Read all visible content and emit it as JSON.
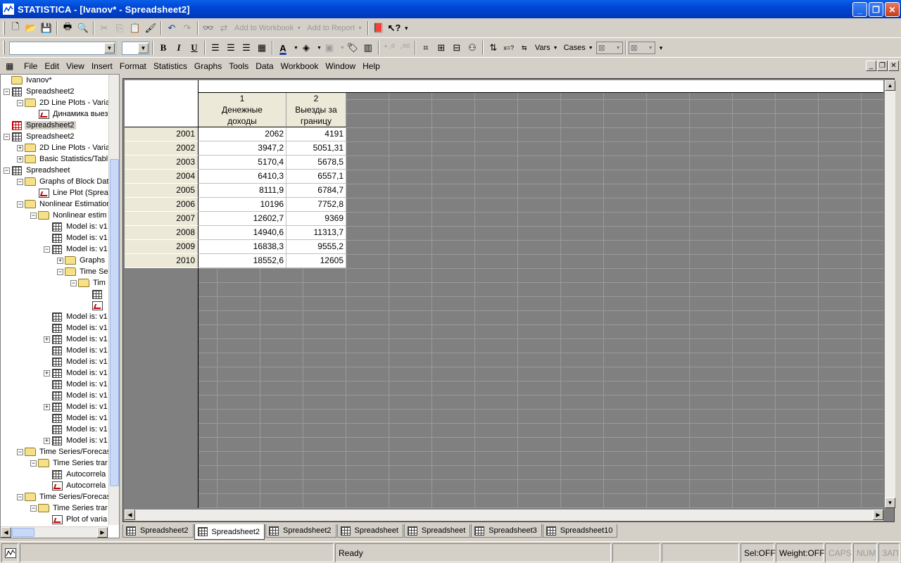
{
  "window": {
    "title": "STATISTICA - [Ivanov* - Spreadsheet2]"
  },
  "toolbar1": {
    "add_to_workbook": "Add to Workbook",
    "add_to_report": "Add to Report"
  },
  "toolbar2": {
    "bold": "B",
    "italic": "I",
    "underline": "U",
    "vars": "Vars",
    "cases": "Cases"
  },
  "menu": [
    "File",
    "Edit",
    "View",
    "Insert",
    "Format",
    "Statistics",
    "Graphs",
    "Tools",
    "Data",
    "Workbook",
    "Window",
    "Help"
  ],
  "tree": [
    {
      "label": "Ivanov*",
      "icon": "folder",
      "level": 0,
      "expander": ""
    },
    {
      "label": "Spreadsheet2",
      "icon": "sheet",
      "level": 0,
      "expander": "-"
    },
    {
      "label": "2D Line Plots - Varia",
      "icon": "folder",
      "level": 1,
      "expander": "-"
    },
    {
      "label": "Динамика выез",
      "icon": "graph",
      "level": 2,
      "expander": ""
    },
    {
      "label": "Spreadsheet2",
      "icon": "sheet-red",
      "level": 0,
      "expander": "",
      "selected": true
    },
    {
      "label": "Spreadsheet2",
      "icon": "sheet",
      "level": 0,
      "expander": "-"
    },
    {
      "label": "2D Line Plots - Varia",
      "icon": "folder",
      "level": 1,
      "expander": "+"
    },
    {
      "label": "Basic Statistics/Tabl",
      "icon": "folder",
      "level": 1,
      "expander": "+"
    },
    {
      "label": "Spreadsheet",
      "icon": "sheet",
      "level": 0,
      "expander": "-"
    },
    {
      "label": "Graphs of Block Dat",
      "icon": "folder",
      "level": 1,
      "expander": "-"
    },
    {
      "label": "Line Plot (Sprea",
      "icon": "graph",
      "level": 2,
      "expander": ""
    },
    {
      "label": "Nonlinear Estimation",
      "icon": "folder",
      "level": 1,
      "expander": "-"
    },
    {
      "label": "Nonlinear estim",
      "icon": "folder",
      "level": 2,
      "expander": "-"
    },
    {
      "label": "Model is: v1",
      "icon": "sheet",
      "level": 3,
      "expander": ""
    },
    {
      "label": "Model is: v1",
      "icon": "sheet",
      "level": 3,
      "expander": ""
    },
    {
      "label": "Model is: v1",
      "icon": "sheet",
      "level": 3,
      "expander": "-"
    },
    {
      "label": "Graphs",
      "icon": "folder",
      "level": 4,
      "expander": "+"
    },
    {
      "label": "Time Se",
      "icon": "folder",
      "level": 4,
      "expander": "-"
    },
    {
      "label": "Tim",
      "icon": "folder",
      "level": 5,
      "expander": "-"
    },
    {
      "label": "",
      "icon": "sheet",
      "level": 6,
      "expander": ""
    },
    {
      "label": "",
      "icon": "graph",
      "level": 6,
      "expander": ""
    },
    {
      "label": "Model is: v1",
      "icon": "sheet",
      "level": 3,
      "expander": ""
    },
    {
      "label": "Model is: v1",
      "icon": "sheet",
      "level": 3,
      "expander": ""
    },
    {
      "label": "Model is: v1",
      "icon": "sheet",
      "level": 3,
      "expander": "+"
    },
    {
      "label": "Model is: v1",
      "icon": "sheet",
      "level": 3,
      "expander": ""
    },
    {
      "label": "Model is: v1",
      "icon": "sheet",
      "level": 3,
      "expander": ""
    },
    {
      "label": "Model is: v1",
      "icon": "sheet",
      "level": 3,
      "expander": "+"
    },
    {
      "label": "Model is: v1",
      "icon": "sheet",
      "level": 3,
      "expander": ""
    },
    {
      "label": "Model is: v1",
      "icon": "sheet",
      "level": 3,
      "expander": ""
    },
    {
      "label": "Model is: v1",
      "icon": "sheet",
      "level": 3,
      "expander": "+"
    },
    {
      "label": "Model is: v1",
      "icon": "sheet",
      "level": 3,
      "expander": ""
    },
    {
      "label": "Model is: v1",
      "icon": "sheet",
      "level": 3,
      "expander": ""
    },
    {
      "label": "Model is: v1",
      "icon": "sheet",
      "level": 3,
      "expander": "+"
    },
    {
      "label": "Time Series/Forecas",
      "icon": "folder",
      "level": 1,
      "expander": "-"
    },
    {
      "label": "Time Series trar",
      "icon": "folder",
      "level": 2,
      "expander": "-"
    },
    {
      "label": "Autocorrela",
      "icon": "sheet",
      "level": 3,
      "expander": ""
    },
    {
      "label": "Autocorrela",
      "icon": "graph",
      "level": 3,
      "expander": ""
    },
    {
      "label": "Time Series/Forecas",
      "icon": "folder",
      "level": 1,
      "expander": "-"
    },
    {
      "label": "Time Series trar",
      "icon": "folder",
      "level": 2,
      "expander": "-"
    },
    {
      "label": "Plot of varia",
      "icon": "graph",
      "level": 3,
      "expander": ""
    }
  ],
  "spreadsheet": {
    "columns": [
      {
        "number": "1",
        "name_line1": "Денежные",
        "name_line2": "доходы"
      },
      {
        "number": "2",
        "name_line1": "Выезды за",
        "name_line2": "границу"
      }
    ],
    "rows": [
      {
        "label": "2001",
        "values": [
          "2062",
          "4191"
        ]
      },
      {
        "label": "2002",
        "values": [
          "3947,2",
          "5051,31"
        ]
      },
      {
        "label": "2003",
        "values": [
          "5170,4",
          "5678,5"
        ]
      },
      {
        "label": "2004",
        "values": [
          "6410,3",
          "6557,1"
        ]
      },
      {
        "label": "2005",
        "values": [
          "8111,9",
          "6784,7"
        ]
      },
      {
        "label": "2006",
        "values": [
          "10196",
          "7752,8"
        ]
      },
      {
        "label": "2007",
        "values": [
          "12602,7",
          "9369"
        ]
      },
      {
        "label": "2008",
        "values": [
          "14940,6",
          "11313,7"
        ]
      },
      {
        "label": "2009",
        "values": [
          "16838,3",
          "9555,2"
        ]
      },
      {
        "label": "2010",
        "values": [
          "18552,6",
          "12605"
        ]
      }
    ]
  },
  "tabs": [
    {
      "label": "Spreadsheet2",
      "active": false
    },
    {
      "label": "Spreadsheet2",
      "active": true
    },
    {
      "label": "Spreadsheet2",
      "active": false
    },
    {
      "label": "Spreadsheet",
      "active": false
    },
    {
      "label": "Spreadsheet",
      "active": false
    },
    {
      "label": "Spreadsheet3",
      "active": false
    },
    {
      "label": "Spreadsheet10",
      "active": false
    }
  ],
  "status": {
    "ready": "Ready",
    "sel": "Sel:OFF",
    "weight": "Weight:OFF",
    "caps": "CAPS",
    "num": "NUM",
    "zap": "ЗАП"
  }
}
